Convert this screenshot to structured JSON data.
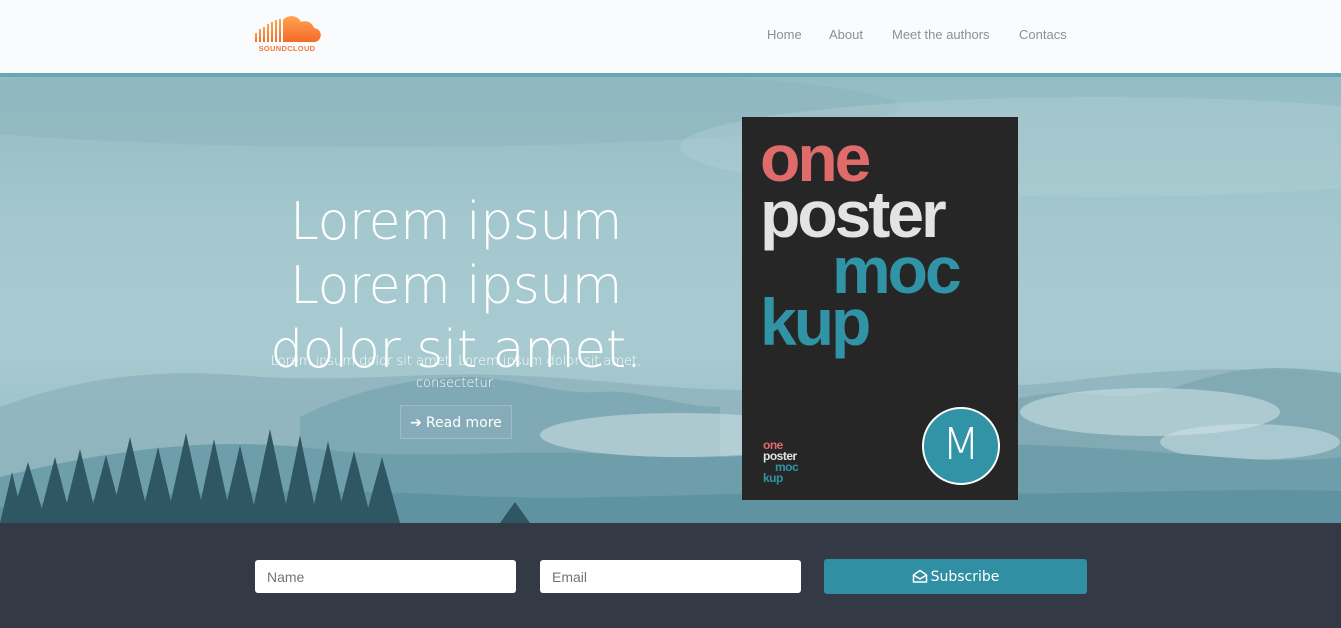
{
  "brand": {
    "name": "SOUNDCLOUD",
    "logo_icon": "soundcloud-cloud-icon",
    "color": "#f47a3a"
  },
  "nav": {
    "items": [
      {
        "label": "Home"
      },
      {
        "label": "About"
      },
      {
        "label": "Meet the authors"
      },
      {
        "label": "Contacs"
      }
    ]
  },
  "hero": {
    "title_lines": [
      "Lorem ipsum",
      "Lorem ipsum",
      "dolor sit amet."
    ],
    "subtitle": "Lorem ipsum dolor sit amet. Lorem ipsum dolor sit amet, consectetur.",
    "cta": {
      "label": "Read more",
      "icon": "arrow-right-icon"
    }
  },
  "poster": {
    "lines": [
      {
        "text": "one",
        "color": "#e06b6b"
      },
      {
        "text": "poster",
        "color": "#e3e3e3"
      },
      {
        "text": "moc",
        "color": "#3194a6"
      },
      {
        "text": "kup",
        "color": "#3194a6"
      }
    ],
    "small_logo": [
      "one",
      "poster",
      "moc",
      "kup"
    ],
    "badge": "M"
  },
  "subscribe_form": {
    "name_placeholder": "Name",
    "email_placeholder": "Email",
    "button_label": "Subscribe",
    "button_icon": "envelope-open-icon",
    "accent": "#318fa4"
  },
  "colors": {
    "nav_border": "#66a8b6",
    "footer_bg": "#343a45",
    "poster_bg": "#262626"
  }
}
